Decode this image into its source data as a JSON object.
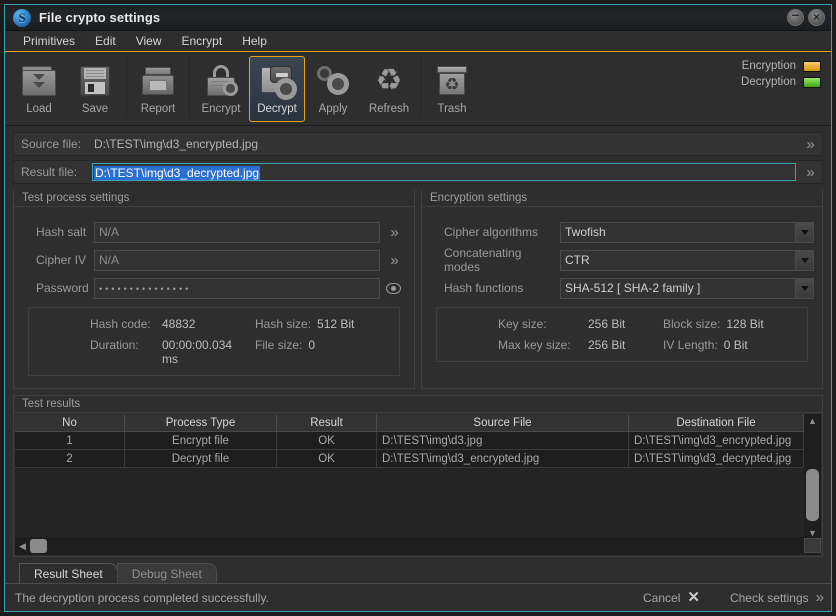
{
  "window": {
    "title": "File crypto settings",
    "logo_letter": "S",
    "minimize_label": "–",
    "close_label": "×"
  },
  "menu": {
    "items": [
      {
        "label": "Primitives"
      },
      {
        "label": "Edit"
      },
      {
        "label": "View"
      },
      {
        "label": "Encrypt"
      },
      {
        "label": "Help"
      }
    ]
  },
  "toolbar": {
    "buttons": [
      {
        "label": "Load",
        "icon": "folder-download-icon",
        "active": false
      },
      {
        "label": "Save",
        "icon": "floppy-disk-icon",
        "active": false
      },
      {
        "label": "Report",
        "icon": "printer-icon",
        "active": false
      },
      {
        "label": "Encrypt",
        "icon": "padlock-gear-icon",
        "active": false
      },
      {
        "label": "Decrypt",
        "icon": "unlock-gear-icon",
        "active": true
      },
      {
        "label": "Apply",
        "icon": "gears-icon",
        "active": false
      },
      {
        "label": "Refresh",
        "icon": "recycle-icon",
        "active": false
      },
      {
        "label": "Trash",
        "icon": "trash-bin-icon",
        "active": false
      }
    ],
    "lamps": [
      {
        "label": "Encryption",
        "color": "#e3ab2e"
      },
      {
        "label": "Decryption",
        "color": "#58c418"
      }
    ]
  },
  "files": {
    "source": {
      "label": "Source file:",
      "value": "D:\\TEST\\img\\d3_encrypted.jpg",
      "browse_glyph": "»"
    },
    "result": {
      "label": "Result file:",
      "value": "D:\\TEST\\img\\d3_decrypted.jpg",
      "browse_glyph": "»",
      "selected": true
    }
  },
  "test_process": {
    "title": "Test process settings",
    "fields": [
      {
        "label": "Hash salt",
        "value": "N/A",
        "kind": "text",
        "button": "»"
      },
      {
        "label": "Cipher IV",
        "value": "N/A",
        "kind": "text",
        "button": "»"
      },
      {
        "label": "Password",
        "value": "•••••••••••••••",
        "kind": "password",
        "button": "eye-icon"
      }
    ],
    "stats": [
      {
        "key": "Hash code:",
        "value": "48832",
        "key2": "Hash size:",
        "value2": "512 Bit"
      },
      {
        "key": "Duration:",
        "value": "00:00:00.034 ms",
        "key2": "File size:",
        "value2": "0"
      }
    ]
  },
  "encryption_settings": {
    "title": "Encryption settings",
    "fields": [
      {
        "label": "Cipher algorithms",
        "value": "Twofish"
      },
      {
        "label": "Concatenating modes",
        "value": "CTR"
      },
      {
        "label": "Hash functions",
        "value": "SHA-512 [ SHA-2 family ]"
      }
    ],
    "stats": [
      {
        "key": "Key size:",
        "value": "256 Bit",
        "key2": "Block size:",
        "value2": "128 Bit"
      },
      {
        "key": "Max key size:",
        "value": "256 Bit",
        "key2": "IV Length:",
        "value2": "0 Bit"
      }
    ]
  },
  "results": {
    "title": "Test results",
    "columns": [
      "No",
      "Process Type",
      "Result",
      "Source File",
      "Destination File"
    ],
    "rows": [
      {
        "no": "1",
        "process_type": "Encrypt file",
        "result": "OK",
        "source_file": "D:\\TEST\\img\\d3.jpg",
        "destination_file": "D:\\TEST\\img\\d3_encrypted.jpg"
      },
      {
        "no": "2",
        "process_type": "Decrypt file",
        "result": "OK",
        "source_file": "D:\\TEST\\img\\d3_encrypted.jpg",
        "destination_file": "D:\\TEST\\img\\d3_decrypted.jpg"
      }
    ]
  },
  "sheet_tabs": [
    {
      "label": "Result Sheet",
      "selected": true
    },
    {
      "label": "Debug Sheet",
      "selected": false
    }
  ],
  "statusbar": {
    "message": "The decryption process completed successfully.",
    "cancel_label": "Cancel",
    "cancel_glyph": "✕",
    "check_label": "Check settings",
    "check_glyph": "»"
  }
}
